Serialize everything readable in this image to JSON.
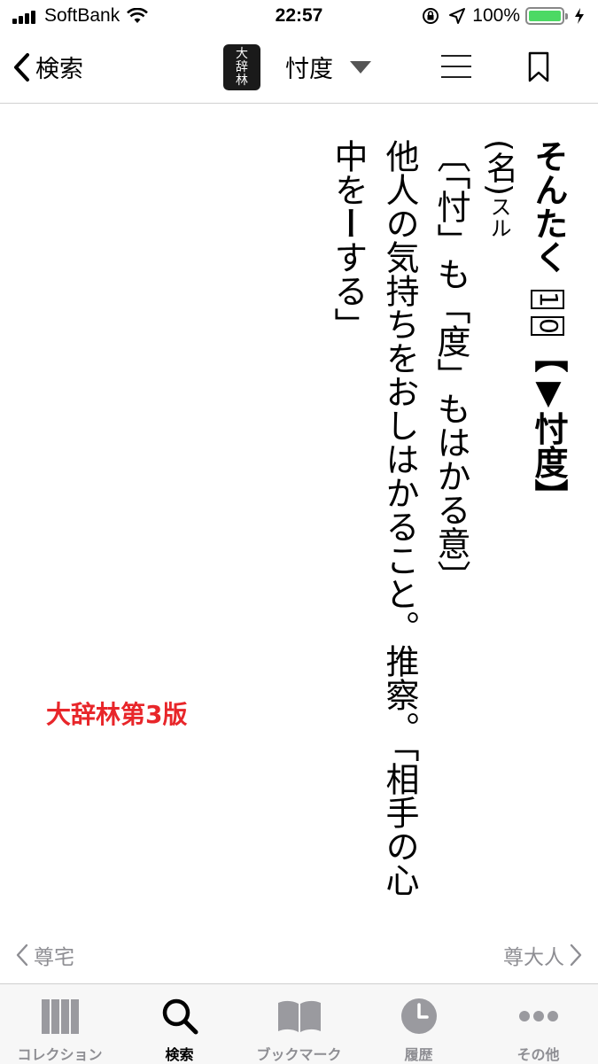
{
  "status_bar": {
    "carrier": "SoftBank",
    "time": "22:57",
    "battery_percent": "100%",
    "battery_level": 1.0,
    "battery_color": "#4cd964"
  },
  "nav": {
    "back_label": "検索",
    "dictionary_icon": {
      "line1": "大",
      "line2": "辞",
      "line3": "林"
    },
    "title": "忖度",
    "menu_icon": "hamburger-icon",
    "bookmark_icon": "bookmark-icon"
  },
  "entry": {
    "reading": "そんたく",
    "num1": "1",
    "num2": "0",
    "headword": "【▼忖度】",
    "pos": "(名)",
    "suru": "スル",
    "etymology": "〔「忖」も「度」もはかる意〕",
    "definition_line1": "他人の気持ちをおしはかること。推察。「相手の心",
    "definition_line2_a": "中を",
    "definition_line2_dash": "ー",
    "definition_line2_b": "する」"
  },
  "edition_label": "大辞林第3版",
  "pager": {
    "prev_label": "尊宅",
    "next_label": "尊大人"
  },
  "tabs": [
    {
      "label": "コレクション",
      "icon": "books-icon",
      "active": false
    },
    {
      "label": "検索",
      "icon": "search-icon",
      "active": true
    },
    {
      "label": "ブックマーク",
      "icon": "open-book-icon",
      "active": false
    },
    {
      "label": "履歴",
      "icon": "clock-icon",
      "active": false
    },
    {
      "label": "その他",
      "icon": "more-dots-icon",
      "active": false
    }
  ],
  "colors": {
    "accent_red": "#e8262a",
    "tab_inactive": "#8e8e93",
    "tab_active": "#000000"
  }
}
